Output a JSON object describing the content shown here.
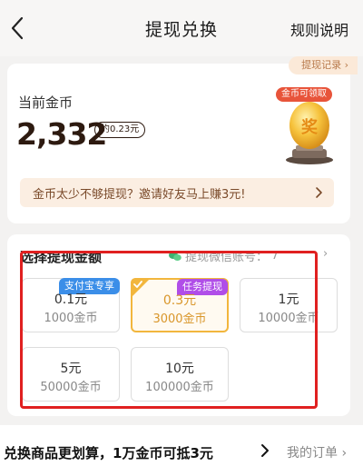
{
  "header": {
    "title": "提现兑换",
    "rules_label": "规则说明"
  },
  "coins": {
    "record_label": "提现记录 ›",
    "label": "当前金币",
    "value": "2,332",
    "approx": "约0.23元",
    "reward_badge": "金币可领取",
    "egg_char": "奖"
  },
  "invite": {
    "text": "金币太少不够提现？邀请好友马上赚3元!"
  },
  "withdraw": {
    "section_title": "选择提现金额",
    "wechat_label": "提现微信账号：",
    "wechat_masked": "7",
    "wechat_more": "›",
    "options": [
      {
        "amount": "0.1元",
        "coins": "1000金币",
        "tag": "支付宝专享",
        "selected": false
      },
      {
        "amount": "0.3元",
        "coins": "3000金币",
        "tag": "任务提现",
        "selected": true
      },
      {
        "amount": "1元",
        "coins": "10000金币",
        "tag": "",
        "selected": false
      },
      {
        "amount": "5元",
        "coins": "50000金币",
        "tag": "",
        "selected": false
      },
      {
        "amount": "10元",
        "coins": "100000金币",
        "tag": "",
        "selected": false
      }
    ]
  },
  "bottom": {
    "promo": "兑换商品更划算，1万金币可抵3元",
    "orders": "我的订单 ›"
  },
  "colors": {
    "accent": "#f2b63d",
    "highlight": "#e02020",
    "badge_red": "#e8543a",
    "tag_blue": "#3b8ee8",
    "tag_purple": "#b04ee8"
  }
}
